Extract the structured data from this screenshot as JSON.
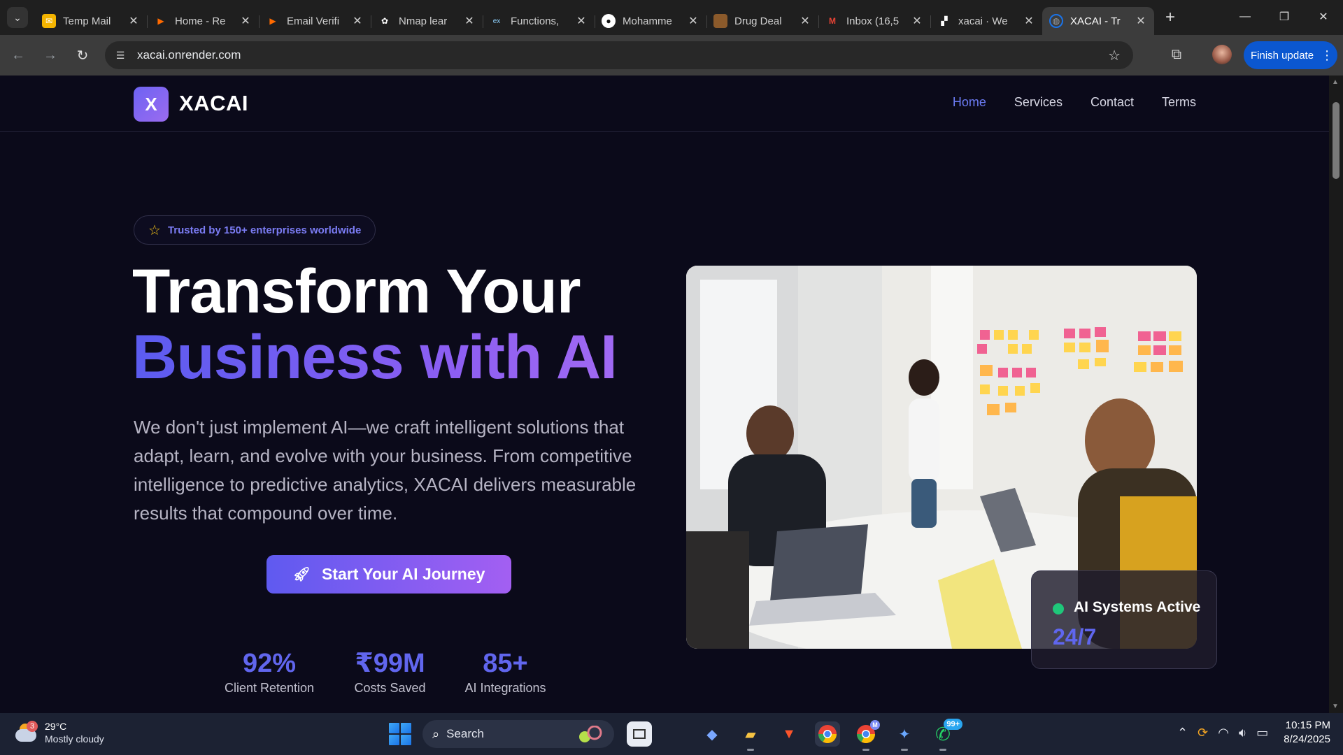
{
  "browser": {
    "tabs": [
      {
        "label": "Temp Mail",
        "favicon": "mail-icon",
        "color": "#f4b400"
      },
      {
        "label": "Home - Re",
        "favicon": "render-icon",
        "color": "#ff6a00"
      },
      {
        "label": "Email Verifi",
        "favicon": "render-icon",
        "color": "#ff6a00"
      },
      {
        "label": "Nmap lear",
        "favicon": "chatgpt-icon",
        "color": "#ffffff"
      },
      {
        "label": "Functions,",
        "favicon": "edx-icon",
        "color": "#00a1e4"
      },
      {
        "label": "Mohamme",
        "favicon": "github-icon",
        "color": "#ffffff"
      },
      {
        "label": "Drug Deal",
        "favicon": "image-icon",
        "color": "#8b5a2b"
      },
      {
        "label": "Inbox (16,5",
        "favicon": "gmail-icon",
        "color": "#ea4335"
      },
      {
        "label": "xacai · We",
        "favicon": "vercel-icon",
        "color": "#ffffff"
      },
      {
        "label": "XACAI - Tr",
        "favicon": "globe-icon",
        "color": "#9aa0a6"
      }
    ],
    "tab_close": "✕",
    "new_tab": "+",
    "url": "xacai.onrender.com",
    "finish_update": "Finish update"
  },
  "site": {
    "logo_letter": "X",
    "brand": "XACAI",
    "nav": [
      "Home",
      "Services",
      "Contact",
      "Terms"
    ],
    "active_nav": "Home"
  },
  "hero": {
    "trust": "Trusted by 150+ enterprises worldwide",
    "title_line1": "Transform Your",
    "title_line2": "Business with AI",
    "description": "We don't just implement AI—we craft intelligent solutions that adapt, learn, and evolve with your business. From competitive intelligence to predictive analytics, XACAI delivers measurable results that compound over time.",
    "cta": "Start Your AI Journey",
    "stats": [
      {
        "value": "92%",
        "label": "Client Retention"
      },
      {
        "value": "₹99M",
        "label": "Costs Saved"
      },
      {
        "value": "85+",
        "label": "AI Integrations"
      }
    ],
    "status_title": "AI Systems Active",
    "status_value": "24/7"
  },
  "taskbar": {
    "weather_temp": "29°C",
    "weather_cond": "Mostly cloudy",
    "weather_badge": "3",
    "search": "Search",
    "whatsapp_badge": "99+",
    "chrome_badge": "M",
    "time": "10:15 PM",
    "date": "8/24/2025"
  },
  "colors": {
    "accent": "#6c7cf4",
    "gradient_start": "#5b5cf0",
    "gradient_end": "#a76df3",
    "status_green": "#1fc77a",
    "page_bg": "#0b0a1a"
  }
}
